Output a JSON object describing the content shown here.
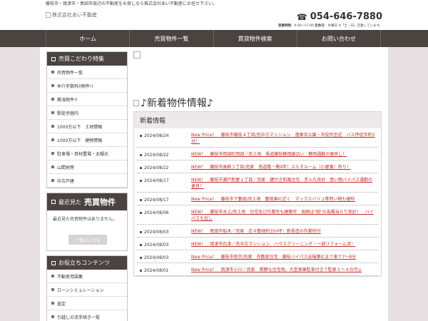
{
  "header": {
    "tagline": "藤枝市・焼津市・島田市周辺の不動産をお探しなら株式会社あい不動産にお任せ下さい。",
    "logo_alt": "株式会社あい不動産",
    "phone": "054-646-7880",
    "hours_label": "営業時間",
    "hours_value": "：9:00～17:00",
    "closed_label": "定休日",
    "closed_value": "：水曜日 ※「土・日」営業しています。"
  },
  "nav": {
    "items": [
      {
        "label": "ホーム"
      },
      {
        "label": "売買物件一覧"
      },
      {
        "label": "賃貸物件検索"
      },
      {
        "label": "お問い合わせ"
      }
    ]
  },
  "sidebar": {
    "features": {
      "title": "売買こだわり特集",
      "items": [
        {
          "label": "売買物件一覧"
        },
        {
          "label": "仲介手数料0物件!!"
        },
        {
          "label": "築浅物件!!"
        },
        {
          "label": "駅徒歩圏内"
        },
        {
          "label": "1000万以下　土地情報"
        },
        {
          "label": "1000万以下　建物情報"
        },
        {
          "label": "駐車場・資材置場・太陽光"
        },
        {
          "label": "山間地等"
        },
        {
          "label": "中古戸建"
        }
      ]
    },
    "recent": {
      "title_small": "最近見た",
      "title_big": "売買物件",
      "empty_text": "最近見た売買物件はありません。",
      "button": "一覧はこちら"
    },
    "useful": {
      "title": "お役立ちコンテンツ",
      "items": [
        {
          "label": "不動産用語集"
        },
        {
          "label": "ローンシミュレーション"
        },
        {
          "label": "査定"
        },
        {
          "label": "引越しの流手続き一覧"
        }
      ]
    }
  },
  "main": {
    "news_title": "♪新着物件情報♪",
    "news_head": "新着情報",
    "news": [
      {
        "date": "2024/08/24",
        "text": "New Price！　藤枝市藤枝４丁目/売中古マンション　蓮華寺公園・市役所至近　バス停徒歩約3分！"
      },
      {
        "date": "2024/08/22",
        "text": "NEW！　藤枝市岡部町岡部／売土地　県道藤枝静岡線沿い　静岡通勤の便良し！"
      },
      {
        "date": "2024/08/22",
        "text": "NEW！　藤枝市高柳３丁目/売家　南道路・築9年！ぶらすルーム（小屋裏）有り！"
      },
      {
        "date": "2024/08/17",
        "text": "NEW！　藤枝市瀬戸新屋１丁目／売家　鍵付き和風住宅　手入れ良好　買い物バイパス通勤の便良！"
      },
      {
        "date": "2024/08/17",
        "text": "New Price！　藤枝市下藪田/売土地　藪田東IC近く　マックスバリュ等買い物も便利"
      },
      {
        "date": "2024/08/06",
        "text": "NEW！　藤枝市水上/売土地　住宅及び作業所も建築可　周囲は\"田\"の為陽当たり良好！　バイパスも近し"
      },
      {
        "date": "2024/08/03",
        "text": "NEW！　島田市船木／売家　広々敷地約350坪！鉄骨造の作業所付"
      },
      {
        "date": "2024/08/03",
        "text": "NEW！　焼津市石津／売中古マンション　ハウスクリーニング・一部リフォーム済！"
      },
      {
        "date": "2024/08/03",
        "text": "New Price！　藤枝市助宗/売家　売敷家住宅　藤枝バイパス谷稲葉ICまで車で7～8分"
      },
      {
        "date": "2024/08/01",
        "text": "New Price！　焼津市小川／売家　閑静な住宅地。大型車庫駐車付きで駐車３～４台可◎"
      }
    ]
  }
}
